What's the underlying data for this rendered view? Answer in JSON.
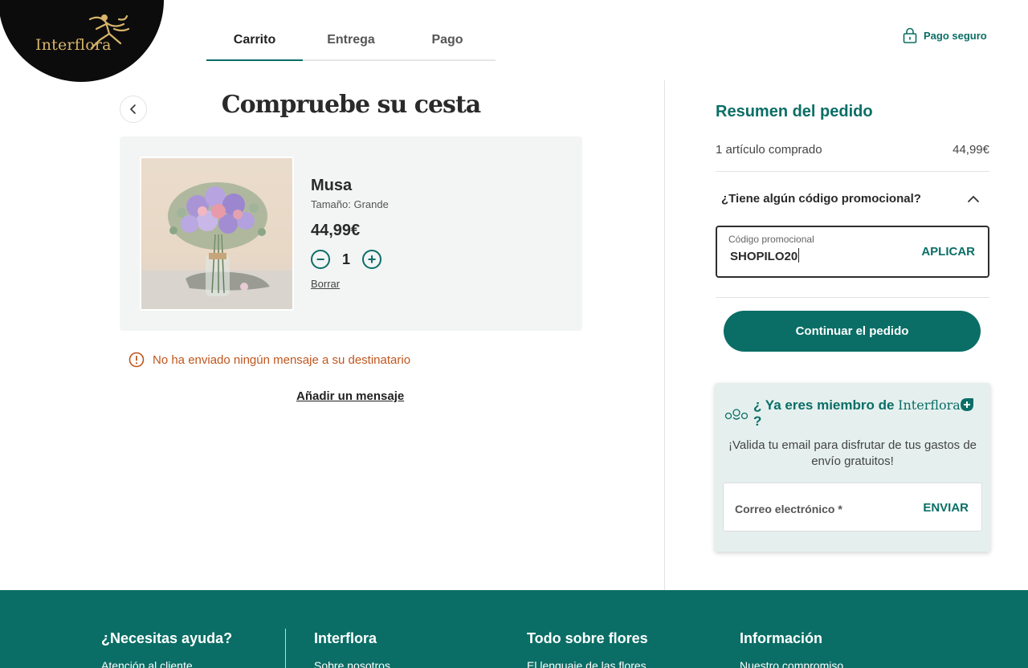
{
  "brand": {
    "name": "Interflora"
  },
  "steps": [
    {
      "label": "Carrito",
      "active": true
    },
    {
      "label": "Entrega",
      "active": false
    },
    {
      "label": "Pago",
      "active": false
    }
  ],
  "header": {
    "secure_label": "Pago seguro"
  },
  "cart": {
    "title": "Compruebe su cesta",
    "product": {
      "name": "Musa",
      "size": "Tamaño: Grande",
      "price": "44,99€",
      "quantity": "1",
      "decrement": "−",
      "increment": "+",
      "remove_label": "Borrar"
    },
    "warning": "No ha enviado ningún mensaje a su destinatario",
    "add_message_label": "Añadir un mensaje"
  },
  "summary": {
    "title": "Resumen del pedido",
    "items_label": "1 artículo comprado",
    "items_price": "44,99€",
    "promo_question": "¿Tiene algún código promocional?",
    "promo_label": "Código promocional",
    "promo_value": "SHOPILO20",
    "promo_apply": "APLICAR",
    "continue_label": "Continuar el pedido"
  },
  "member": {
    "title_prefix": "¿ Ya eres miembro de",
    "title_brand": "Interflora",
    "title_suffix": "?",
    "text": "¡Valida tu email para disfrutar de tus gastos de envío gratuitos!",
    "email_placeholder": "Correo electrónico *",
    "send_label": "ENVIAR"
  },
  "footer": {
    "columns": [
      {
        "heading": "¿Necesitas ayuda?",
        "first_link": "Atención al cliente"
      },
      {
        "heading": "Interflora",
        "first_link": "Sobre nosotros"
      },
      {
        "heading": "Todo sobre flores",
        "first_link": "El lenguaje de las flores"
      },
      {
        "heading": "Información",
        "first_link": "Nuestro compromiso"
      }
    ]
  },
  "colors": {
    "accent": "#0a6e66",
    "warning": "#c0561e",
    "logo_gold": "#d8b56a"
  },
  "icons": [
    "padlock-icon",
    "chevron-left-icon",
    "chevron-up-icon",
    "alert-circle-icon",
    "flowers-icon",
    "plus-badge-icon"
  ]
}
